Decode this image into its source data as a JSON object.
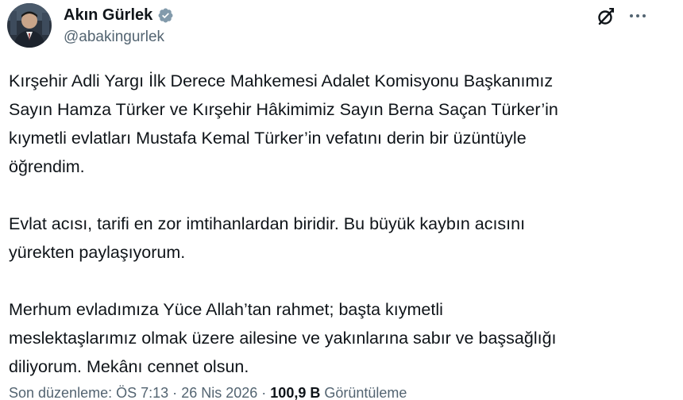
{
  "author": {
    "display_name": "Akın Gürlek",
    "handle": "@abakingurlek",
    "verified": true,
    "avatar_icon": "profile-photo"
  },
  "actions": {
    "grok_icon": "grok-icon",
    "more_icon": "more-options-icon"
  },
  "tweet": {
    "paragraphs": [
      "Kırşehir Adli Yargı İlk Derece Mahkemesi Adalet Komisyonu Başkanımız\nSayın Hamza Türker ve Kırşehir Hâkimimiz Sayın Berna Saçan Türker’in\nkıymetli evlatları Mustafa Kemal Türker’in vefatını derin bir üzüntüyle\nöğrendim.",
      "Evlat acısı, tarifi en zor imtihanlardan biridir. Bu büyük kaybın acısını\nyürekten paylaşıyorum.",
      "Merhum evladımıza Yüce Allah’tan rahmet; başta kıymetli\nmeslektaşlarımız olmak üzere ailesine ve yakınlarına sabır ve başsağlığı\ndiliyorum. Mekânı cennet olsun."
    ]
  },
  "meta": {
    "edited_label": "Son düzenleme:",
    "time": "ÖS 7:13",
    "separator": "·",
    "date": "26 Nis 2026",
    "views_count": "100,9 B",
    "views_label": "Görüntüleme"
  },
  "colors": {
    "text_primary": "#0f1419",
    "text_secondary": "#536471",
    "verified_badge": "#829aab"
  }
}
